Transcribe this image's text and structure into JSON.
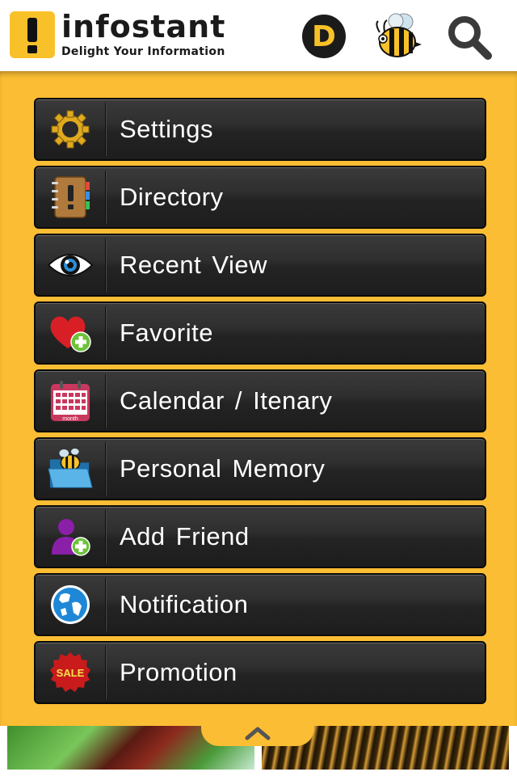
{
  "header": {
    "brand_name": "infostant",
    "tagline": "Delight Your Information",
    "d_button_label": "D"
  },
  "menu": {
    "items": [
      {
        "label": "Settings",
        "icon": "gear-icon"
      },
      {
        "label": "Directory",
        "icon": "address-book-icon"
      },
      {
        "label": "Recent View",
        "icon": "eye-icon"
      },
      {
        "label": "Favorite",
        "icon": "heart-plus-icon"
      },
      {
        "label": "Calendar / Itenary",
        "icon": "calendar-icon",
        "calendar_caption": "month"
      },
      {
        "label": "Personal Memory",
        "icon": "folder-bee-icon"
      },
      {
        "label": "Add Friend",
        "icon": "add-user-icon"
      },
      {
        "label": "Notification",
        "icon": "globe-icon"
      },
      {
        "label": "Promotion",
        "icon": "sale-badge-icon",
        "badge_text": "SALE"
      }
    ]
  },
  "colors": {
    "accent_yellow": "#fbbd33",
    "menu_dark": "#252525",
    "text_white": "#ffffff"
  }
}
